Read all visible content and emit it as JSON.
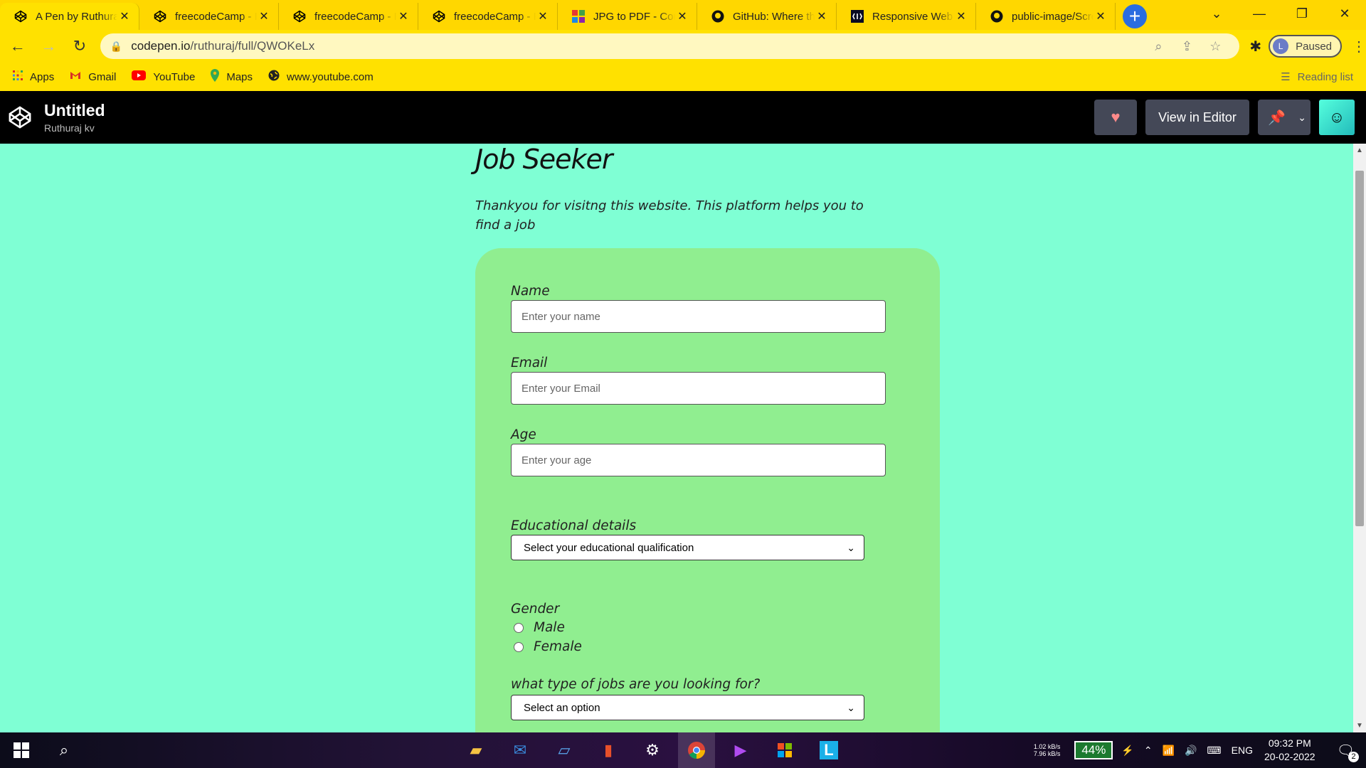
{
  "browser": {
    "tabs": [
      {
        "title": "A Pen by Ruthuraj kv",
        "icon": "codepen-icon",
        "active": true
      },
      {
        "title": "freecodeCamp - Pen",
        "icon": "codepen-icon"
      },
      {
        "title": "freecodeCamp - Pen",
        "icon": "codepen-icon"
      },
      {
        "title": "freecodeCamp - Pen",
        "icon": "codepen-icon"
      },
      {
        "title": "JPG to PDF - Convert",
        "icon": "ilovepdf-icon"
      },
      {
        "title": "GitHub: Where the world",
        "icon": "github-icon"
      },
      {
        "title": "Responsive Web Design",
        "icon": "freecodecamp-icon"
      },
      {
        "title": "public-image/Screenshot",
        "icon": "github-icon"
      }
    ],
    "new_tab": "+",
    "url_domain": "codepen.io",
    "url_path": "/ruthuraj/full/QWOKeLx",
    "profile_initial": "L",
    "profile_status": "Paused",
    "bookmarks": [
      {
        "label": "Apps",
        "icon": "apps-grid-icon"
      },
      {
        "label": "Gmail",
        "icon": "gmail-icon"
      },
      {
        "label": "YouTube",
        "icon": "youtube-icon"
      },
      {
        "label": "Maps",
        "icon": "maps-icon"
      },
      {
        "label": "www.youtube.com",
        "icon": "globe-icon"
      }
    ],
    "reading_list": "Reading list"
  },
  "codepen": {
    "title": "Untitled",
    "author": "Ruthuraj kv",
    "view_in_editor": "View in Editor"
  },
  "page": {
    "heading": "Job Seeker",
    "description": "Thankyou for visitng this website. This platform helps you to find a job",
    "fields": {
      "name_label": "Name",
      "name_placeholder": "Enter your name",
      "email_label": "Email",
      "email_placeholder": "Enter your Email",
      "age_label": "Age",
      "age_placeholder": "Enter your age",
      "education_label": "Educational details",
      "education_selected": "Select your educational qualification",
      "gender_label": "Gender",
      "gender_options": [
        "Male",
        "Female"
      ],
      "jobs_label": "what type of jobs are you looking for?",
      "jobs_selected": "Select an option"
    }
  },
  "taskbar": {
    "net_up": "1.02 kB/s",
    "net_down": "7.96 kB/s",
    "battery": "44%",
    "language": "ENG",
    "time": "09:32 PM",
    "date": "20-02-2022",
    "notifications": "2"
  },
  "colors": {
    "page_bg": "#7fffd4",
    "card_bg": "#90ee90",
    "chrome_theme": "#ffd700",
    "codepen_header": "#000000",
    "button_bg": "#444857"
  }
}
